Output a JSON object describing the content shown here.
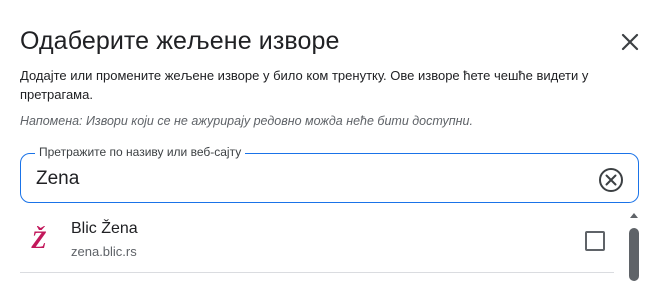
{
  "dialog": {
    "title": "Одаберите жељене изворе",
    "description": "Додајте или промените жељене изворе у било ком тренутку. Ове изворе ћете чешће видети у претрагама.",
    "note": "Напомена: Извори који се не ажурирају редовно можда неће бити доступни."
  },
  "search": {
    "label": "Претражите по називу или веб-сајту",
    "value": "Zena"
  },
  "results": [
    {
      "logo_text": "Ž",
      "name": "Blic Žena",
      "url": "zena.blic.rs",
      "checked": false
    }
  ],
  "icons": {
    "close": "close-icon",
    "clear": "clear-circle-icon",
    "scroll_up": "chevron-up-icon"
  },
  "colors": {
    "accent": "#1a73e8",
    "logo": "#c2185b",
    "text": "#202124",
    "secondary_text": "#5f6368"
  }
}
